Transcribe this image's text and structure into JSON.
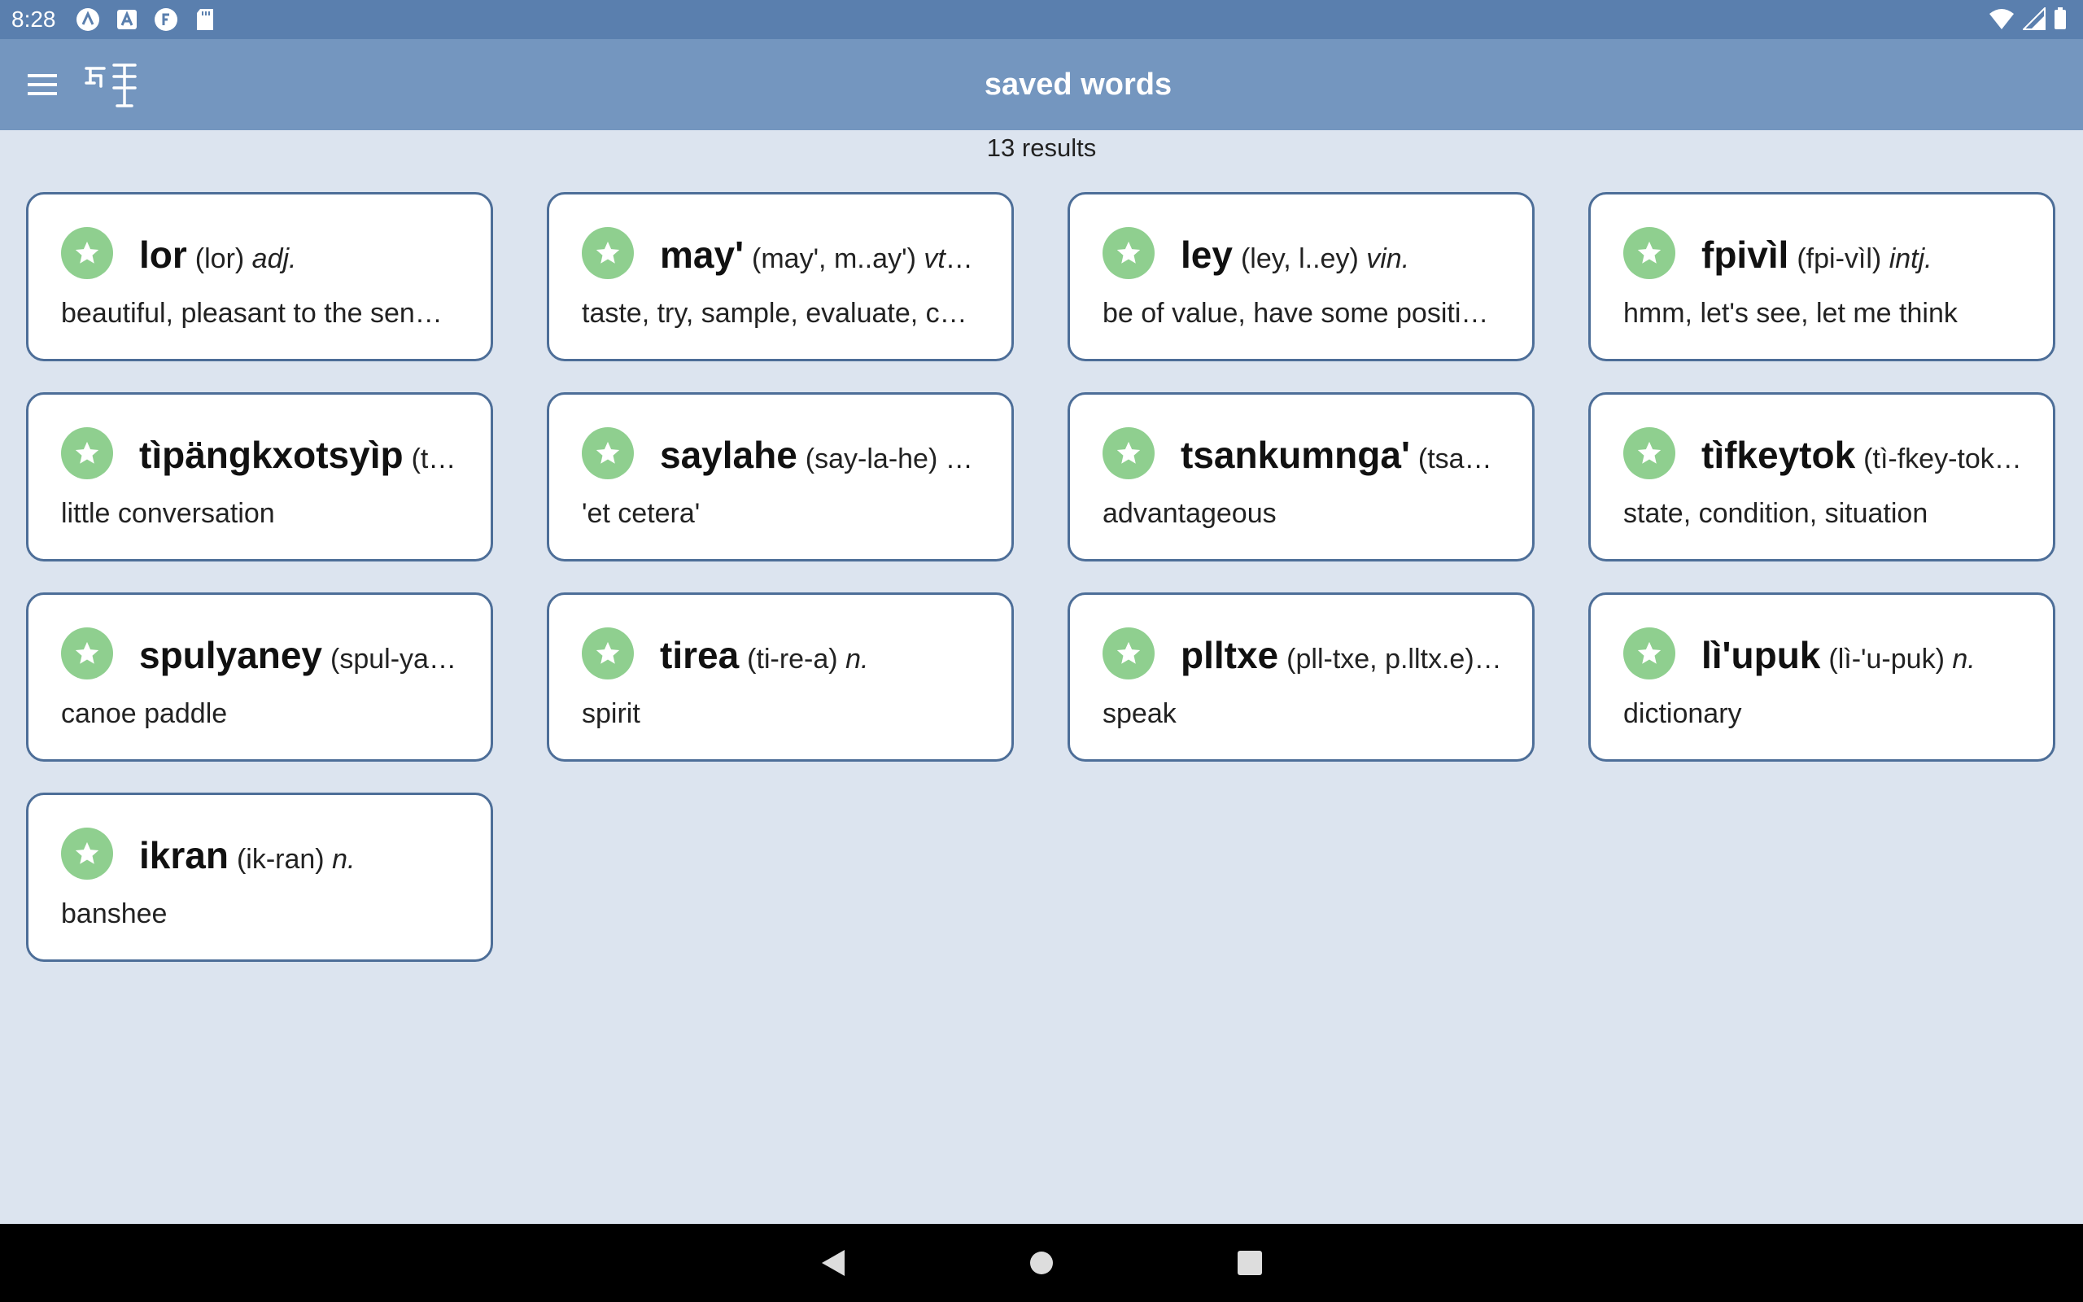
{
  "status_bar": {
    "time": "8:28",
    "icons": [
      "a-icon",
      "text-a-icon",
      "f-icon",
      "sd-card-icon"
    ],
    "right_icons": [
      "wifi-icon",
      "signal-icon",
      "battery-icon"
    ]
  },
  "app_bar": {
    "title": "saved words",
    "menu_icon": "hamburger-menu-icon",
    "filter_icon": "na'vi-filter-icon"
  },
  "results": "13 results",
  "colors": {
    "status_bar": "#5a7fae",
    "app_bar": "#7496bf",
    "background": "#dce4ef",
    "card_border": "#4d6e98",
    "star": "#8fcf8f"
  },
  "cards": [
    {
      "word": "lor",
      "pron": "(lor)",
      "pos": "adj.",
      "def": "beautiful, pleasant to the sen…"
    },
    {
      "word": "may'",
      "pron": "(may', m..ay')",
      "pos": "vtr…",
      "def": "taste, try, sample, evaluate, c…"
    },
    {
      "word": "ley",
      "pron": "(ley, l..ey)",
      "pos": "vin.",
      "def": "be of value, have some positi…"
    },
    {
      "word": "fpivìl",
      "pron": "(fpi-vìl)",
      "pos": "intj.",
      "def": "hmm, let's see, let me think"
    },
    {
      "word": "tìpängkxotsyìp",
      "pron": "(tì-…",
      "pos": "",
      "def": "little conversation"
    },
    {
      "word": "saylahe",
      "pron": "(say-la-he)",
      "pos": "a…",
      "def": "'et cetera'"
    },
    {
      "word": "tsankumnga'",
      "pron": "(tsan…",
      "pos": "",
      "def": "advantageous"
    },
    {
      "word": "tìfkeytok",
      "pron": "(tì-fkey-tok…",
      "pos": "",
      "def": "state, condition, situation"
    },
    {
      "word": "spulyaney",
      "pron": "(spul-ya-…",
      "pos": "",
      "def": "canoe paddle"
    },
    {
      "word": "tirea",
      "pron": "(ti-re-a)",
      "pos": "n.",
      "def": "spirit"
    },
    {
      "word": "plltxe",
      "pron": "(pll-txe, p.lltx.e)…",
      "pos": "",
      "def": "speak"
    },
    {
      "word": "lì'upuk",
      "pron": "(lì-'u-puk)",
      "pos": "n.",
      "def": "dictionary"
    },
    {
      "word": "ikran",
      "pron": "(ik-ran)",
      "pos": "n.",
      "def": "banshee"
    }
  ],
  "nav_bar": {
    "buttons": [
      "back-icon",
      "home-icon",
      "recents-icon"
    ]
  }
}
